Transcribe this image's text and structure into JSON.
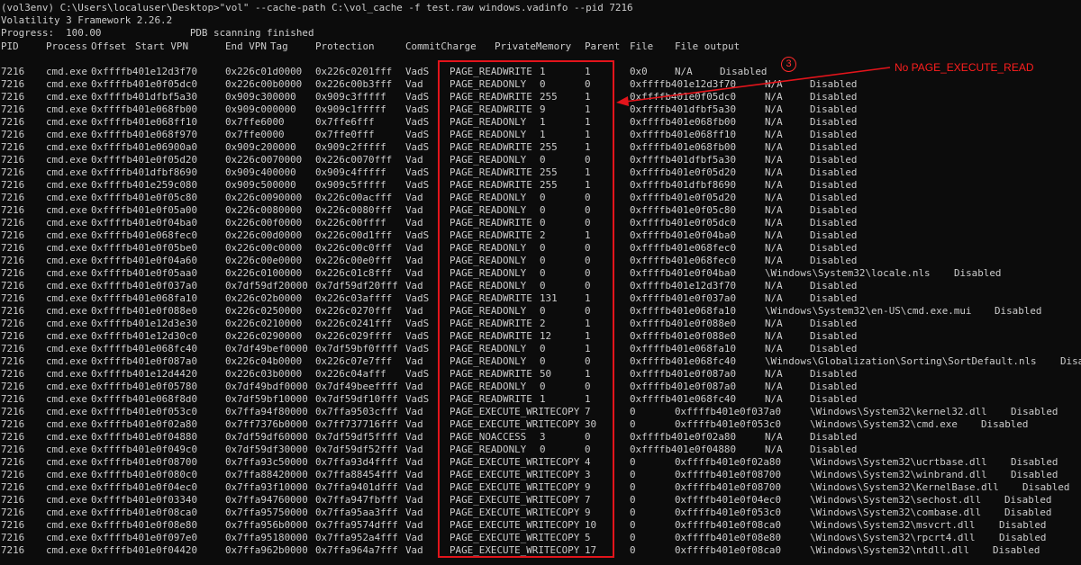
{
  "console": {
    "command_line": "(vol3env) C:\\Users\\localuser\\Desktop>\"vol\" --cache-path C:\\vol_cache -f test.raw windows.vadinfo --pid 7216",
    "framework_line": "Volatility 3 Framework 2.26.2",
    "progress_line": "Progress:  100.00               PDB scanning finished"
  },
  "table": {
    "headers": [
      "PID",
      "Process",
      "Offset",
      "Start VPN",
      "End VPN",
      "Tag",
      "Protection",
      "CommitCharge",
      "PrivateMemory",
      "Parent",
      "File",
      "File output"
    ],
    "rows": [
      {
        "pid": "7216",
        "proc": "cmd.exe",
        "offset": "0xffffb401e12d3f70",
        "start": "0x226c01d0000",
        "end": "0x226c0201fff",
        "tag": "VadS",
        "prot": "PAGE_READWRITE",
        "commit": "1",
        "priv": "1",
        "parent": "0x0",
        "file": "N/A",
        "out": "Disabled"
      },
      {
        "pid": "7216",
        "proc": "cmd.exe",
        "offset": "0xffffb401e0f05dc0",
        "start": "0x226c00b0000",
        "end": "0x226c00b3fff",
        "tag": "Vad",
        "prot": "PAGE_READONLY",
        "commit": "0",
        "priv": "0",
        "parent": "0xffffb401e12d3f70",
        "file": "N/A",
        "out": "Disabled"
      },
      {
        "pid": "7216",
        "proc": "cmd.exe",
        "offset": "0xffffb401dfbf5a30",
        "start": "0x909c300000",
        "end": "0x909c3fffff",
        "tag": "VadS",
        "prot": "PAGE_READWRITE",
        "commit": "255",
        "priv": "1",
        "parent": "0xffffb401e0f05dc0",
        "file": "N/A",
        "out": "Disabled"
      },
      {
        "pid": "7216",
        "proc": "cmd.exe",
        "offset": "0xffffb401e068fb00",
        "start": "0x909c000000",
        "end": "0x909c1fffff",
        "tag": "VadS",
        "prot": "PAGE_READWRITE",
        "commit": "9",
        "priv": "1",
        "parent": "0xffffb401dfbf5a30",
        "file": "N/A",
        "out": "Disabled"
      },
      {
        "pid": "7216",
        "proc": "cmd.exe",
        "offset": "0xffffb401e068ff10",
        "start": "0x7ffe6000",
        "end": "0x7ffe6fff",
        "tag": "VadS",
        "prot": "PAGE_READONLY",
        "commit": "1",
        "priv": "1",
        "parent": "0xffffb401e068fb00",
        "file": "N/A",
        "out": "Disabled"
      },
      {
        "pid": "7216",
        "proc": "cmd.exe",
        "offset": "0xffffb401e068f970",
        "start": "0x7ffe0000",
        "end": "0x7ffe0fff",
        "tag": "VadS",
        "prot": "PAGE_READONLY",
        "commit": "1",
        "priv": "1",
        "parent": "0xffffb401e068ff10",
        "file": "N/A",
        "out": "Disabled"
      },
      {
        "pid": "7216",
        "proc": "cmd.exe",
        "offset": "0xffffb401e06900a0",
        "start": "0x909c200000",
        "end": "0x909c2fffff",
        "tag": "VadS",
        "prot": "PAGE_READWRITE",
        "commit": "255",
        "priv": "1",
        "parent": "0xffffb401e068fb00",
        "file": "N/A",
        "out": "Disabled"
      },
      {
        "pid": "7216",
        "proc": "cmd.exe",
        "offset": "0xffffb401e0f05d20",
        "start": "0x226c0070000",
        "end": "0x226c0070fff",
        "tag": "Vad",
        "prot": "PAGE_READONLY",
        "commit": "0",
        "priv": "0",
        "parent": "0xffffb401dfbf5a30",
        "file": "N/A",
        "out": "Disabled"
      },
      {
        "pid": "7216",
        "proc": "cmd.exe",
        "offset": "0xffffb401dfbf8690",
        "start": "0x909c400000",
        "end": "0x909c4fffff",
        "tag": "VadS",
        "prot": "PAGE_READWRITE",
        "commit": "255",
        "priv": "1",
        "parent": "0xffffb401e0f05d20",
        "file": "N/A",
        "out": "Disabled"
      },
      {
        "pid": "7216",
        "proc": "cmd.exe",
        "offset": "0xffffb401e259c080",
        "start": "0x909c500000",
        "end": "0x909c5fffff",
        "tag": "VadS",
        "prot": "PAGE_READWRITE",
        "commit": "255",
        "priv": "1",
        "parent": "0xffffb401dfbf8690",
        "file": "N/A",
        "out": "Disabled"
      },
      {
        "pid": "7216",
        "proc": "cmd.exe",
        "offset": "0xffffb401e0f05c80",
        "start": "0x226c0090000",
        "end": "0x226c00acfff",
        "tag": "Vad",
        "prot": "PAGE_READONLY",
        "commit": "0",
        "priv": "0",
        "parent": "0xffffb401e0f05d20",
        "file": "N/A",
        "out": "Disabled"
      },
      {
        "pid": "7216",
        "proc": "cmd.exe",
        "offset": "0xffffb401e0f05a00",
        "start": "0x226c0080000",
        "end": "0x226c0080fff",
        "tag": "Vad",
        "prot": "PAGE_READONLY",
        "commit": "0",
        "priv": "0",
        "parent": "0xffffb401e0f05c80",
        "file": "N/A",
        "out": "Disabled"
      },
      {
        "pid": "7216",
        "proc": "cmd.exe",
        "offset": "0xffffb401e0f04ba0",
        "start": "0x226c00f0000",
        "end": "0x226c00ffff",
        "tag": "Vad",
        "prot": "PAGE_READWRITE",
        "commit": "0",
        "priv": "0",
        "parent": "0xffffb401e0f05dc0",
        "file": "N/A",
        "out": "Disabled"
      },
      {
        "pid": "7216",
        "proc": "cmd.exe",
        "offset": "0xffffb401e068fec0",
        "start": "0x226c00d0000",
        "end": "0x226c00d1fff",
        "tag": "VadS",
        "prot": "PAGE_READWRITE",
        "commit": "2",
        "priv": "1",
        "parent": "0xffffb401e0f04ba0",
        "file": "N/A",
        "out": "Disabled"
      },
      {
        "pid": "7216",
        "proc": "cmd.exe",
        "offset": "0xffffb401e0f05be0",
        "start": "0x226c00c0000",
        "end": "0x226c00c0fff",
        "tag": "Vad",
        "prot": "PAGE_READONLY",
        "commit": "0",
        "priv": "0",
        "parent": "0xffffb401e068fec0",
        "file": "N/A",
        "out": "Disabled"
      },
      {
        "pid": "7216",
        "proc": "cmd.exe",
        "offset": "0xffffb401e0f04a60",
        "start": "0x226c00e0000",
        "end": "0x226c00e0fff",
        "tag": "Vad",
        "prot": "PAGE_READONLY",
        "commit": "0",
        "priv": "0",
        "parent": "0xffffb401e068fec0",
        "file": "N/A",
        "out": "Disabled"
      },
      {
        "pid": "7216",
        "proc": "cmd.exe",
        "offset": "0xffffb401e0f05aa0",
        "start": "0x226c0100000",
        "end": "0x226c01c8fff",
        "tag": "Vad",
        "prot": "PAGE_READONLY",
        "commit": "0",
        "priv": "0",
        "parent": "0xffffb401e0f04ba0",
        "file": "\\Windows\\System32\\locale.nls",
        "out": "Disabled"
      },
      {
        "pid": "7216",
        "proc": "cmd.exe",
        "offset": "0xffffb401e0f037a0",
        "start": "0x7df59df20000",
        "end": "0x7df59df20fff",
        "tag": "Vad",
        "prot": "PAGE_READONLY",
        "commit": "0",
        "priv": "0",
        "parent": "0xffffb401e12d3f70",
        "file": "N/A",
        "out": "Disabled"
      },
      {
        "pid": "7216",
        "proc": "cmd.exe",
        "offset": "0xffffb401e068fa10",
        "start": "0x226c02b0000",
        "end": "0x226c03affff",
        "tag": "VadS",
        "prot": "PAGE_READWRITE",
        "commit": "131",
        "priv": "1",
        "parent": "0xffffb401e0f037a0",
        "file": "N/A",
        "out": "Disabled"
      },
      {
        "pid": "7216",
        "proc": "cmd.exe",
        "offset": "0xffffb401e0f088e0",
        "start": "0x226c0250000",
        "end": "0x226c0270fff",
        "tag": "Vad",
        "prot": "PAGE_READONLY",
        "commit": "0",
        "priv": "0",
        "parent": "0xffffb401e068fa10",
        "file": "\\Windows\\System32\\en-US\\cmd.exe.mui",
        "out": "Disabled"
      },
      {
        "pid": "7216",
        "proc": "cmd.exe",
        "offset": "0xffffb401e12d3e30",
        "start": "0x226c0210000",
        "end": "0x226c0241fff",
        "tag": "VadS",
        "prot": "PAGE_READWRITE",
        "commit": "2",
        "priv": "1",
        "parent": "0xffffb401e0f088e0",
        "file": "N/A",
        "out": "Disabled"
      },
      {
        "pid": "7216",
        "proc": "cmd.exe",
        "offset": "0xffffb401e12d30c0",
        "start": "0x226c0290000",
        "end": "0x226c029ffff",
        "tag": "VadS",
        "prot": "PAGE_READWRITE",
        "commit": "12",
        "priv": "1",
        "parent": "0xffffb401e0f088e0",
        "file": "N/A",
        "out": "Disabled"
      },
      {
        "pid": "7216",
        "proc": "cmd.exe",
        "offset": "0xffffb401e068fc40",
        "start": "0x7df49bef0000",
        "end": "0x7df59bf0ffff",
        "tag": "VadS",
        "prot": "PAGE_READONLY",
        "commit": "0",
        "priv": "1",
        "parent": "0xffffb401e068fa10",
        "file": "N/A",
        "out": "Disabled"
      },
      {
        "pid": "7216",
        "proc": "cmd.exe",
        "offset": "0xffffb401e0f087a0",
        "start": "0x226c04b0000",
        "end": "0x226c07e7fff",
        "tag": "Vad",
        "prot": "PAGE_READONLY",
        "commit": "0",
        "priv": "0",
        "parent": "0xffffb401e068fc40",
        "file": "\\Windows\\Globalization\\Sorting\\SortDefault.nls",
        "out": "Disabled"
      },
      {
        "pid": "7216",
        "proc": "cmd.exe",
        "offset": "0xffffb401e12d4420",
        "start": "0x226c03b0000",
        "end": "0x226c04afff",
        "tag": "VadS",
        "prot": "PAGE_READWRITE",
        "commit": "50",
        "priv": "1",
        "parent": "0xffffb401e0f087a0",
        "file": "N/A",
        "out": "Disabled"
      },
      {
        "pid": "7216",
        "proc": "cmd.exe",
        "offset": "0xffffb401e0f05780",
        "start": "0x7df49bdf0000",
        "end": "0x7df49beeffff",
        "tag": "Vad",
        "prot": "PAGE_READONLY",
        "commit": "0",
        "priv": "0",
        "parent": "0xffffb401e0f087a0",
        "file": "N/A",
        "out": "Disabled"
      },
      {
        "pid": "7216",
        "proc": "cmd.exe",
        "offset": "0xffffb401e068f8d0",
        "start": "0x7df59bf10000",
        "end": "0x7df59df10fff",
        "tag": "VadS",
        "prot": "PAGE_READWRITE",
        "commit": "1",
        "priv": "1",
        "parent": "0xffffb401e068fc40",
        "file": "N/A",
        "out": "Disabled"
      },
      {
        "pid": "7216",
        "proc": "cmd.exe",
        "offset": "0xffffb401e0f053c0",
        "start": "0x7ffa94f80000",
        "end": "0x7ffa9503cfff",
        "tag": "Vad",
        "prot": "PAGE_EXECUTE_WRITECOPY",
        "commit": "7",
        "priv": "0",
        "parent": "0xffffb401e0f037a0",
        "file": "\\Windows\\System32\\kernel32.dll",
        "out": "Disabled"
      },
      {
        "pid": "7216",
        "proc": "cmd.exe",
        "offset": "0xffffb401e0f02a80",
        "start": "0x7ff7376b0000",
        "end": "0x7ff737716fff",
        "tag": "Vad",
        "prot": "PAGE_EXECUTE_WRITECOPY",
        "commit": "30",
        "priv": "0",
        "parent": "0xffffb401e0f053c0",
        "file": "\\Windows\\System32\\cmd.exe",
        "out": "Disabled"
      },
      {
        "pid": "7216",
        "proc": "cmd.exe",
        "offset": "0xffffb401e0f04880",
        "start": "0x7df59df60000",
        "end": "0x7df59df5ffff",
        "tag": "Vad",
        "prot": "PAGE_NOACCESS",
        "commit": "3",
        "priv": "0",
        "parent": "0xffffb401e0f02a80",
        "file": "N/A",
        "out": "Disabled"
      },
      {
        "pid": "7216",
        "proc": "cmd.exe",
        "offset": "0xffffb401e0f049c0",
        "start": "0x7df59df30000",
        "end": "0x7df59df52fff",
        "tag": "Vad",
        "prot": "PAGE_READONLY",
        "commit": "0",
        "priv": "0",
        "parent": "0xffffb401e0f04880",
        "file": "N/A",
        "out": "Disabled"
      },
      {
        "pid": "7216",
        "proc": "cmd.exe",
        "offset": "0xffffb401e0f08700",
        "start": "0x7ffa93c50000",
        "end": "0x7ffa93d4ffff",
        "tag": "Vad",
        "prot": "PAGE_EXECUTE_WRITECOPY",
        "commit": "4",
        "priv": "0",
        "parent": "0xffffb401e0f02a80",
        "file": "\\Windows\\System32\\ucrtbase.dll",
        "out": "Disabled"
      },
      {
        "pid": "7216",
        "proc": "cmd.exe",
        "offset": "0xffffb401e0f080c0",
        "start": "0x7ffa88420000",
        "end": "0x7ffa88454fff",
        "tag": "Vad",
        "prot": "PAGE_EXECUTE_WRITECOPY",
        "commit": "3",
        "priv": "0",
        "parent": "0xffffb401e0f08700",
        "file": "\\Windows\\System32\\winbrand.dll",
        "out": "Disabled"
      },
      {
        "pid": "7216",
        "proc": "cmd.exe",
        "offset": "0xffffb401e0f04ec0",
        "start": "0x7ffa93f10000",
        "end": "0x7ffa9401dfff",
        "tag": "Vad",
        "prot": "PAGE_EXECUTE_WRITECOPY",
        "commit": "9",
        "priv": "0",
        "parent": "0xffffb401e0f08700",
        "file": "\\Windows\\System32\\KernelBase.dll",
        "out": "Disabled"
      },
      {
        "pid": "7216",
        "proc": "cmd.exe",
        "offset": "0xffffb401e0f03340",
        "start": "0x7ffa94760000",
        "end": "0x7ffa947fbfff",
        "tag": "Vad",
        "prot": "PAGE_EXECUTE_WRITECOPY",
        "commit": "7",
        "priv": "0",
        "parent": "0xffffb401e0f04ec0",
        "file": "\\Windows\\System32\\sechost.dll",
        "out": "Disabled"
      },
      {
        "pid": "7216",
        "proc": "cmd.exe",
        "offset": "0xffffb401e0f08ca0",
        "start": "0x7ffa95750000",
        "end": "0x7ffa95aa3fff",
        "tag": "Vad",
        "prot": "PAGE_EXECUTE_WRITECOPY",
        "commit": "9",
        "priv": "0",
        "parent": "0xffffb401e0f053c0",
        "file": "\\Windows\\System32\\combase.dll",
        "out": "Disabled"
      },
      {
        "pid": "7216",
        "proc": "cmd.exe",
        "offset": "0xffffb401e0f08e80",
        "start": "0x7ffa956b0000",
        "end": "0x7ffa9574dfff",
        "tag": "Vad",
        "prot": "PAGE_EXECUTE_WRITECOPY",
        "commit": "10",
        "priv": "0",
        "parent": "0xffffb401e0f08ca0",
        "file": "\\Windows\\System32\\msvcrt.dll",
        "out": "Disabled"
      },
      {
        "pid": "7216",
        "proc": "cmd.exe",
        "offset": "0xffffb401e0f097e0",
        "start": "0x7ffa95180000",
        "end": "0x7ffa952a4fff",
        "tag": "Vad",
        "prot": "PAGE_EXECUTE_WRITECOPY",
        "commit": "5",
        "priv": "0",
        "parent": "0xffffb401e0f08e80",
        "file": "\\Windows\\System32\\rpcrt4.dll",
        "out": "Disabled"
      },
      {
        "pid": "7216",
        "proc": "cmd.exe",
        "offset": "0xffffb401e0f04420",
        "start": "0x7ffa962b0000",
        "end": "0x7ffa964a7fff",
        "tag": "Vad",
        "prot": "PAGE_EXECUTE_WRITECOPY",
        "commit": "17",
        "priv": "0",
        "parent": "0xffffb401e0f08ca0",
        "file": "\\Windows\\System32\\ntdll.dll",
        "out": "Disabled"
      }
    ]
  },
  "annotation": {
    "step_number": "3",
    "callout": "No PAGE_EXECUTE_READ",
    "color": "#e3141b"
  }
}
